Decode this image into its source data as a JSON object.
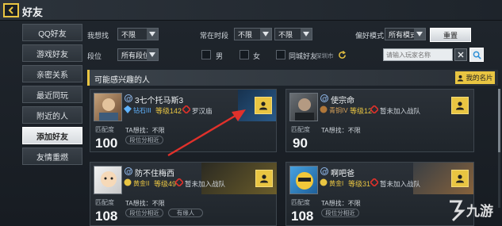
{
  "header": {
    "title": "好友"
  },
  "nav": {
    "items": [
      {
        "label": "QQ好友",
        "active": false
      },
      {
        "label": "游戏好友",
        "active": false
      },
      {
        "label": "亲密关系",
        "active": false
      },
      {
        "label": "最近同玩",
        "active": false
      },
      {
        "label": "附近的人",
        "active": false
      },
      {
        "label": "添加好友",
        "active": true
      },
      {
        "label": "友情重燃",
        "active": false
      }
    ]
  },
  "filter": {
    "want_label": "我想找",
    "want_value": "不限",
    "online_time_label": "常在时段",
    "online_time_from": "不限",
    "online_time_to": "不限",
    "preferred_mode_label": "偏好模式",
    "preferred_mode_value": "所有模式",
    "reset_label": "重置",
    "rank_label": "段位",
    "rank_value": "所有段位",
    "male_label": "男",
    "female_label": "女",
    "same_city_label": "同城好友",
    "city": "深圳市",
    "search_placeholder": "请输入玩家名称"
  },
  "section": {
    "title": "可能感兴趣的人",
    "my_card_label": "我的名片"
  },
  "common": {
    "match_label": "匹配度",
    "ta_want_label": "TA想找：不限",
    "rank_range_label": "段位分相近",
    "peer_label": "有缘人"
  },
  "players": [
    {
      "name": "3七个托马斯3",
      "rank": "钻石III",
      "level": "等级142",
      "extra": "罗汉庙",
      "match": "100",
      "rank_color": "#5fb3ff"
    },
    {
      "name": "使宗命",
      "rank": "青铜IV",
      "level": "等级12",
      "extra": "暂未加入战队",
      "match": "90",
      "rank_color": "#d8a25a"
    },
    {
      "name": "防不住梅西",
      "rank": "黄金II",
      "level": "等级49",
      "extra": "暂未加入战队",
      "match": "108",
      "rank_color": "#e9c542"
    },
    {
      "name": "啊吧爸",
      "rank": "黄金I",
      "level": "等级31",
      "extra": "暂未加入战队",
      "match": "108",
      "rank_color": "#e9c542"
    }
  ],
  "watermark": {
    "text": "九游"
  },
  "colors": {
    "accent": "#e9c542",
    "arrow": "#e0312b"
  }
}
